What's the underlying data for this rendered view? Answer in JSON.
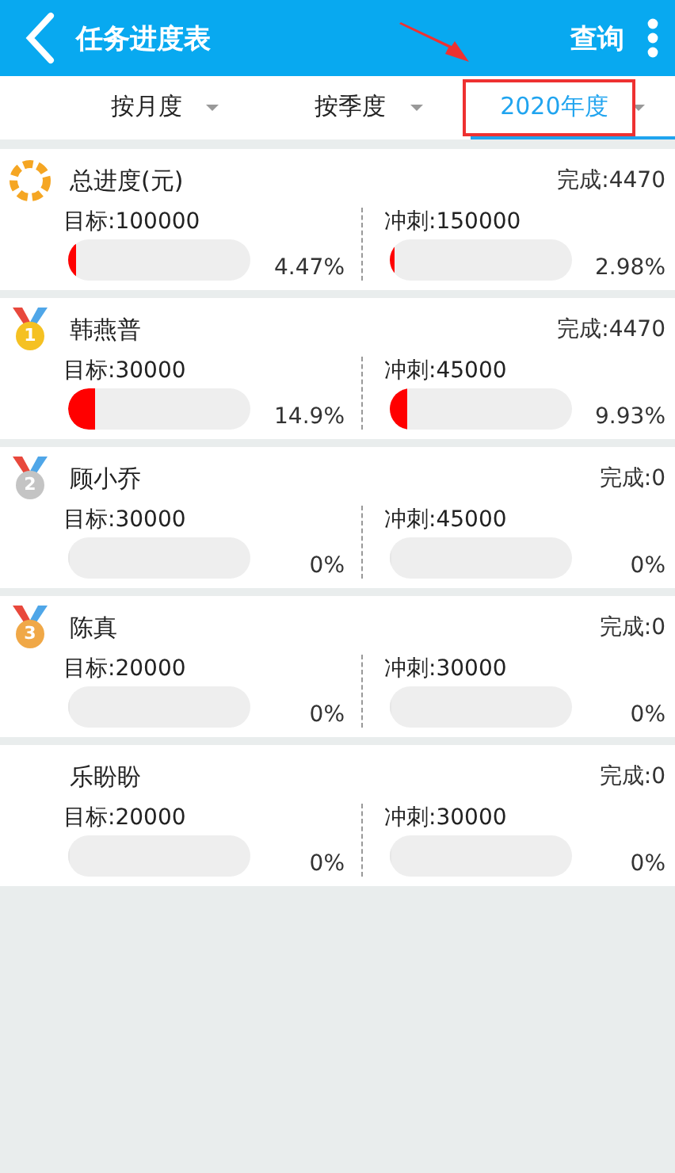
{
  "header": {
    "title": "任务进度表",
    "action": "查询"
  },
  "tabs": [
    {
      "label": "按月度",
      "selected": false
    },
    {
      "label": "按季度",
      "selected": false
    },
    {
      "label": "2020年度",
      "selected": true
    }
  ],
  "rows": [
    {
      "kind": "total",
      "name": "总进度(元)",
      "done": "完成:4470",
      "target": {
        "label": "目标:100000",
        "level": 0.0447,
        "percent": "4.47%"
      },
      "sprint": {
        "label": "冲刺:150000",
        "level": 0.0298,
        "percent": "2.98%"
      }
    },
    {
      "kind": "medal",
      "rank": "1",
      "color": "#f5c122",
      "name": "韩燕普",
      "done": "完成:4470",
      "target": {
        "label": "目标:30000",
        "level": 0.149,
        "percent": "14.9%"
      },
      "sprint": {
        "label": "冲刺:45000",
        "level": 0.0993,
        "percent": "9.93%"
      }
    },
    {
      "kind": "medal",
      "rank": "2",
      "color": "#c4c4c4",
      "name": "顾小乔",
      "done": "完成:0",
      "target": {
        "label": "目标:30000",
        "level": 0,
        "percent": "0%"
      },
      "sprint": {
        "label": "冲刺:45000",
        "level": 0,
        "percent": "0%"
      }
    },
    {
      "kind": "medal",
      "rank": "3",
      "color": "#f0a847",
      "name": "陈真",
      "done": "完成:0",
      "target": {
        "label": "目标:20000",
        "level": 0,
        "percent": "0%"
      },
      "sprint": {
        "label": "冲刺:30000",
        "level": 0,
        "percent": "0%"
      }
    },
    {
      "kind": "plain",
      "name": "乐盼盼",
      "done": "完成:0",
      "target": {
        "label": "目标:20000",
        "level": 0,
        "percent": "0%"
      },
      "sprint": {
        "label": "冲刺:30000",
        "level": 0,
        "percent": "0%"
      }
    }
  ]
}
